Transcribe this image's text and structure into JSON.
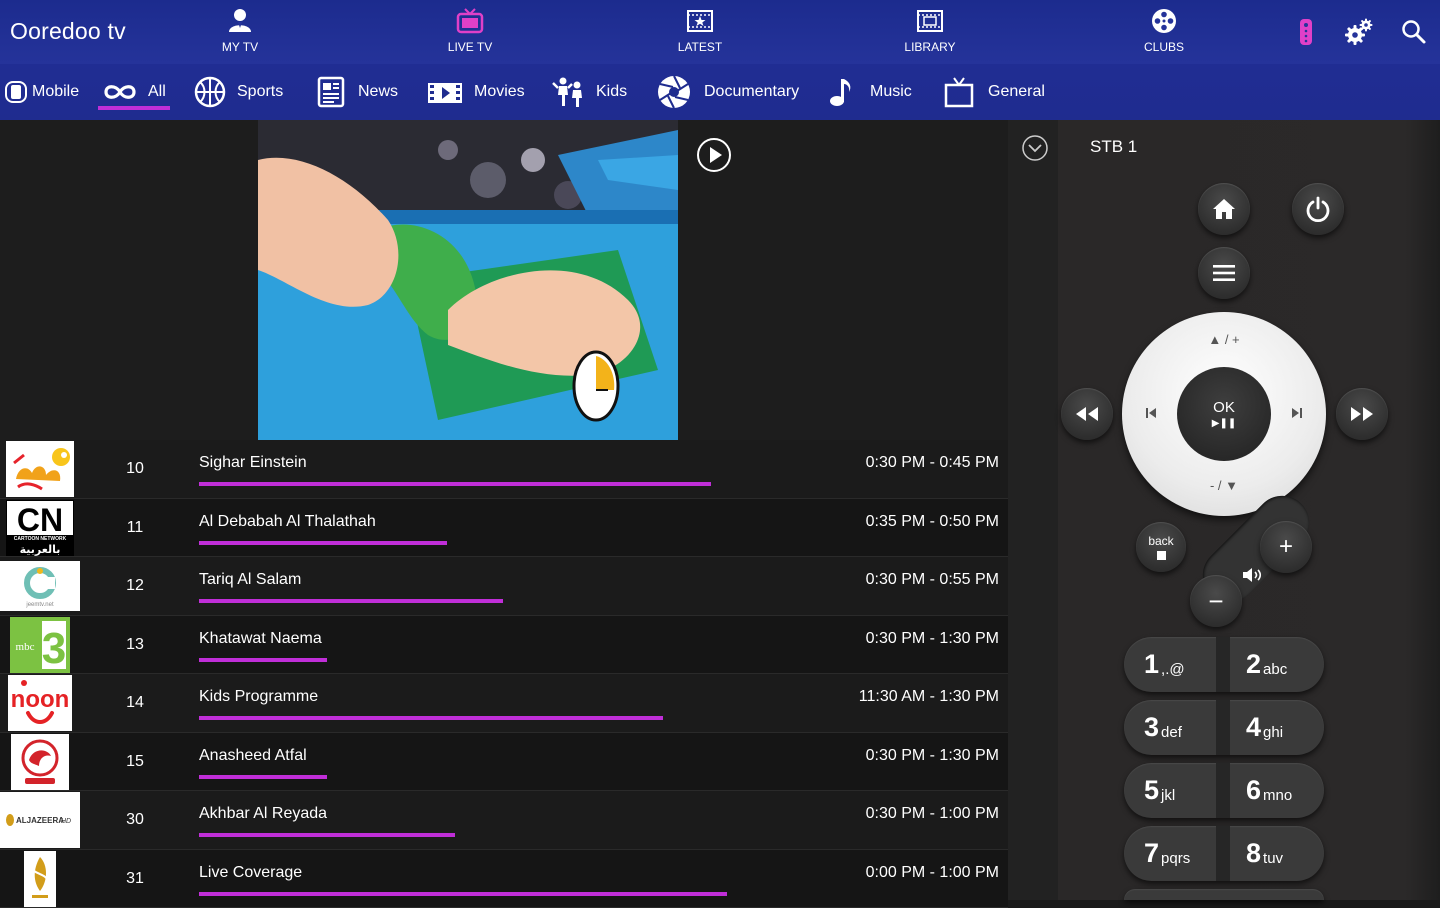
{
  "header": {
    "brand": "Ooredoo tv",
    "nav": [
      {
        "label": "MY TV",
        "icon": "user-icon"
      },
      {
        "label": "LIVE TV",
        "icon": "tv-icon"
      },
      {
        "label": "LATEST",
        "icon": "star-film-icon"
      },
      {
        "label": "LIBRARY",
        "icon": "film-strip-icon"
      },
      {
        "label": "CLUBS",
        "icon": "film-reel-icon"
      }
    ],
    "right_icons": [
      "remote-icon",
      "settings-icon",
      "search-icon"
    ]
  },
  "categories": [
    {
      "label": "Mobile",
      "icon": "mobile-icon"
    },
    {
      "label": "All",
      "icon": "infinity-icon",
      "active": true
    },
    {
      "label": "Sports",
      "icon": "basketball-icon"
    },
    {
      "label": "News",
      "icon": "newspaper-icon"
    },
    {
      "label": "Movies",
      "icon": "clapper-icon"
    },
    {
      "label": "Kids",
      "icon": "kids-icon"
    },
    {
      "label": "Documentary",
      "icon": "camera-shutter-icon"
    },
    {
      "label": "Music",
      "icon": "music-note-icon"
    },
    {
      "label": "General",
      "icon": "tv-general-icon"
    }
  ],
  "channels": [
    {
      "number": "10",
      "program": "Sighar Einstein",
      "time": "0:30 PM - 0:45 PM",
      "progress": 0.64,
      "logo": "majid-logo"
    },
    {
      "number": "11",
      "program": "Al Debabah Al Thalathah",
      "time": "0:35 PM - 0:50 PM",
      "progress": 0.31,
      "logo": "cartoon-network-arabic-logo"
    },
    {
      "number": "12",
      "program": "Tariq Al Salam",
      "time": "0:30 PM - 0:55 PM",
      "progress": 0.38,
      "logo": "jeem-logo"
    },
    {
      "number": "13",
      "program": "Khatawat Naema",
      "time": "0:30 PM - 1:30 PM",
      "progress": 0.16,
      "logo": "mbc3-logo"
    },
    {
      "number": "14",
      "program": "Kids Programme",
      "time": "11:30 AM - 1:30 PM",
      "progress": 0.58,
      "logo": "noon-logo"
    },
    {
      "number": "15",
      "program": "Anasheed Atfal",
      "time": "0:30 PM - 1:30 PM",
      "progress": 0.16,
      "logo": "toyor-aljanah-logo"
    },
    {
      "number": "30",
      "program": "Akhbar Al Reyada",
      "time": "0:30 PM - 1:00 PM",
      "progress": 0.32,
      "logo": "aljazeera-hd-logo"
    },
    {
      "number": "31",
      "program": "Live Coverage",
      "time": "0:00 PM - 1:00 PM",
      "progress": 0.66,
      "logo": "aljazeera-logo"
    }
  ],
  "logos": {
    "cn_text": "CN",
    "cn_sub": "CARTOON NETWORK",
    "cn_arabic": "بالعربية",
    "mbc_text": "mbc",
    "mbc_num": "3",
    "noon_text": "noon",
    "aljazeera_text": "ALJAZEERA",
    "aljazeera_hd": "HD",
    "jeem_text": "jeemtv.net"
  },
  "remote": {
    "stb_label": "STB 1",
    "ok_label": "OK",
    "ok_sub": "▶︎❚❚",
    "up_label": "▲ / +",
    "down_label": "- / ▼",
    "back_label": "back",
    "vol_plus": "+",
    "vol_minus": "−",
    "keys": [
      {
        "num": "1",
        "sub": ",.@"
      },
      {
        "num": "2",
        "sub": "abc"
      },
      {
        "num": "3",
        "sub": "def"
      },
      {
        "num": "4",
        "sub": "ghi"
      },
      {
        "num": "5",
        "sub": "jkl"
      },
      {
        "num": "6",
        "sub": "mno"
      },
      {
        "num": "7",
        "sub": "pqrs"
      },
      {
        "num": "8",
        "sub": "tuv"
      }
    ]
  },
  "colors": {
    "header_blue": "#1f2c8f",
    "accent_purple": "#c02ed8",
    "remote_pink": "#e040c8"
  }
}
